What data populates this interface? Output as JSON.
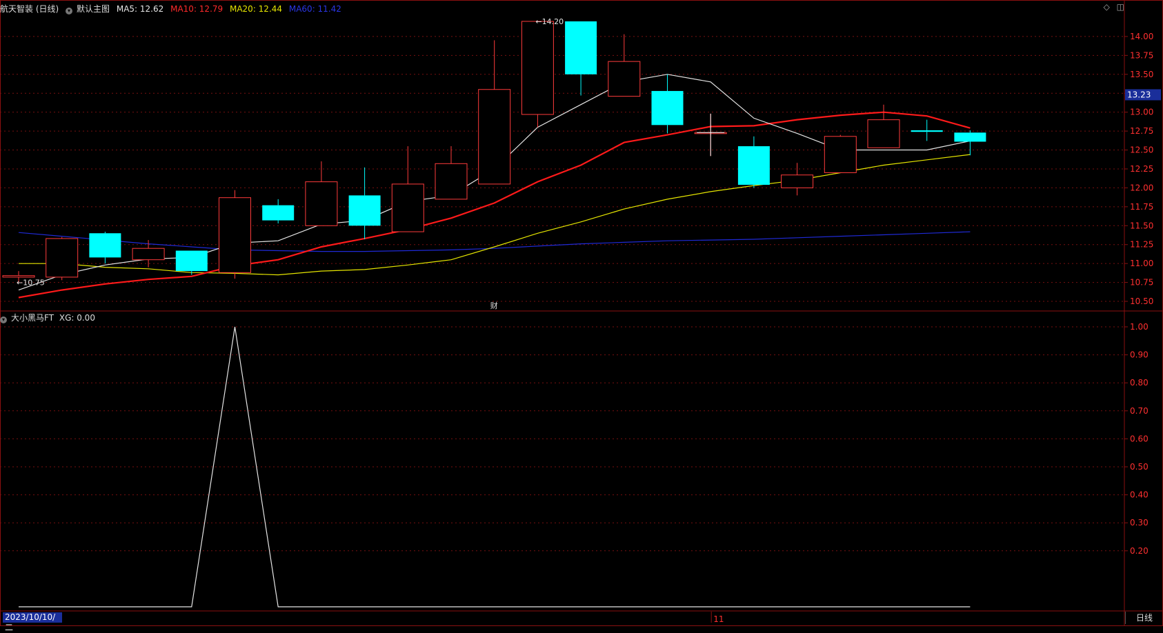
{
  "header": {
    "stock": "航天智装 (日线)",
    "template": "默认主图",
    "ma5": "MA5: 12.62",
    "ma10": "MA10: 12.79",
    "ma20": "MA20: 12.44",
    "ma60": "MA60: 11.42"
  },
  "sub_header": {
    "indicator": "大小黑马FT",
    "xg": "XG: 0.00"
  },
  "footer": {
    "date": "2023/10/10/二",
    "period_tab": "日线",
    "month_marker": "11"
  },
  "colors": {
    "up": "#ff3b3b",
    "down": "#00ffff",
    "ma5": "#e6e6e6",
    "ma10": "#ff1a1a",
    "ma20": "#e6e600",
    "ma60": "#1f2ad6",
    "grid": "#7a1010"
  },
  "chart_data": [
    {
      "type": "candlestick",
      "title": "航天智装 (日线)",
      "ylim": [
        10.4,
        14.3
      ],
      "y_ticks": [
        10.5,
        10.75,
        11.0,
        11.25,
        11.5,
        11.75,
        12.0,
        12.25,
        12.5,
        12.75,
        13.0,
        13.25,
        13.5,
        13.75,
        14.0
      ],
      "y_tick_labels": [
        "10.50",
        "10.75",
        "11.00",
        "11.25",
        "11.50",
        "11.75",
        "12.00",
        "12.25",
        "12.50",
        "12.75",
        "13.00",
        "13.25",
        "13.50",
        "13.75",
        "14.00"
      ],
      "current_price": "13.23",
      "annotations": [
        {
          "text": "←10.75",
          "index": 0,
          "value": 10.75
        },
        {
          "text": "←14.20",
          "index": 12,
          "value": 14.2
        },
        {
          "text": "财",
          "index": 11,
          "value": null
        }
      ],
      "candles": [
        {
          "o": 10.82,
          "h": 10.9,
          "l": 10.75,
          "c": 10.84
        },
        {
          "o": 10.82,
          "h": 11.35,
          "l": 10.78,
          "c": 11.33
        },
        {
          "o": 11.4,
          "h": 11.42,
          "l": 11.0,
          "c": 11.08
        },
        {
          "o": 11.05,
          "h": 11.31,
          "l": 10.95,
          "c": 11.2
        },
        {
          "o": 11.17,
          "h": 11.17,
          "l": 10.85,
          "c": 10.9
        },
        {
          "o": 10.88,
          "h": 11.97,
          "l": 10.8,
          "c": 11.87
        },
        {
          "o": 11.77,
          "h": 11.85,
          "l": 11.53,
          "c": 11.57
        },
        {
          "o": 11.5,
          "h": 12.35,
          "l": 11.5,
          "c": 12.08
        },
        {
          "o": 11.9,
          "h": 12.27,
          "l": 11.32,
          "c": 11.5
        },
        {
          "o": 11.42,
          "h": 12.55,
          "l": 11.42,
          "c": 12.05
        },
        {
          "o": 11.85,
          "h": 12.55,
          "l": 11.85,
          "c": 12.32
        },
        {
          "o": 12.05,
          "h": 13.95,
          "l": 12.05,
          "c": 13.3
        },
        {
          "o": 12.97,
          "h": 14.2,
          "l": 12.8,
          "c": 14.2
        },
        {
          "o": 14.2,
          "h": 14.2,
          "l": 13.22,
          "c": 13.5
        },
        {
          "o": 13.21,
          "h": 14.03,
          "l": 13.21,
          "c": 13.67
        },
        {
          "o": 13.28,
          "h": 13.5,
          "l": 12.72,
          "c": 12.83
        },
        {
          "o": 12.73,
          "h": 12.98,
          "l": 12.42,
          "c": 12.73
        },
        {
          "o": 12.55,
          "h": 12.68,
          "l": 12.0,
          "c": 12.04
        },
        {
          "o": 12.0,
          "h": 12.33,
          "l": 11.9,
          "c": 12.17
        },
        {
          "o": 12.2,
          "h": 12.7,
          "l": 12.2,
          "c": 12.68
        },
        {
          "o": 12.53,
          "h": 13.1,
          "l": 12.53,
          "c": 12.9
        },
        {
          "o": 12.76,
          "h": 12.9,
          "l": 12.62,
          "c": 12.74
        },
        {
          "o": 12.73,
          "h": 12.76,
          "l": 12.43,
          "c": 12.61
        }
      ],
      "series": [
        {
          "name": "MA5",
          "values": [
            10.65,
            10.85,
            10.98,
            11.06,
            11.08,
            11.27,
            11.3,
            11.52,
            11.57,
            11.82,
            11.9,
            12.25,
            12.8,
            13.1,
            13.4,
            13.5,
            13.4,
            12.92,
            12.72,
            12.5,
            12.5,
            12.5,
            12.62
          ]
        },
        {
          "name": "MA10",
          "values": [
            10.55,
            10.65,
            10.73,
            10.79,
            10.83,
            10.97,
            11.05,
            11.22,
            11.33,
            11.45,
            11.6,
            11.8,
            12.08,
            12.3,
            12.6,
            12.7,
            12.81,
            12.82,
            12.9,
            12.96,
            13.0,
            12.95,
            12.79
          ]
        },
        {
          "name": "MA20",
          "values": [
            11.0,
            11.0,
            10.95,
            10.93,
            10.88,
            10.87,
            10.85,
            10.9,
            10.92,
            10.98,
            11.05,
            11.22,
            11.4,
            11.55,
            11.72,
            11.85,
            11.95,
            12.03,
            12.1,
            12.2,
            12.3,
            12.37,
            12.44
          ]
        },
        {
          "name": "MA60",
          "values": [
            11.41,
            11.36,
            11.31,
            11.26,
            11.22,
            11.18,
            11.17,
            11.16,
            11.16,
            11.17,
            11.18,
            11.2,
            11.23,
            11.26,
            11.28,
            11.3,
            11.31,
            11.32,
            11.34,
            11.36,
            11.38,
            11.4,
            11.42
          ]
        }
      ]
    },
    {
      "type": "line",
      "title": "大小黑马FT",
      "ylim": [
        0,
        1.05
      ],
      "y_ticks": [
        0.2,
        0.3,
        0.4,
        0.5,
        0.6,
        0.7,
        0.8,
        0.9,
        1.0
      ],
      "y_tick_labels": [
        "0.20",
        "0.30",
        "0.40",
        "0.50",
        "0.60",
        "0.70",
        "0.80",
        "0.90",
        "1.00"
      ],
      "series": [
        {
          "name": "XG",
          "values": [
            0,
            0,
            0,
            0,
            0,
            1,
            0,
            0,
            0,
            0,
            0,
            0,
            0,
            0,
            0,
            0,
            0,
            0,
            0,
            0,
            0,
            0,
            0
          ]
        }
      ]
    }
  ]
}
